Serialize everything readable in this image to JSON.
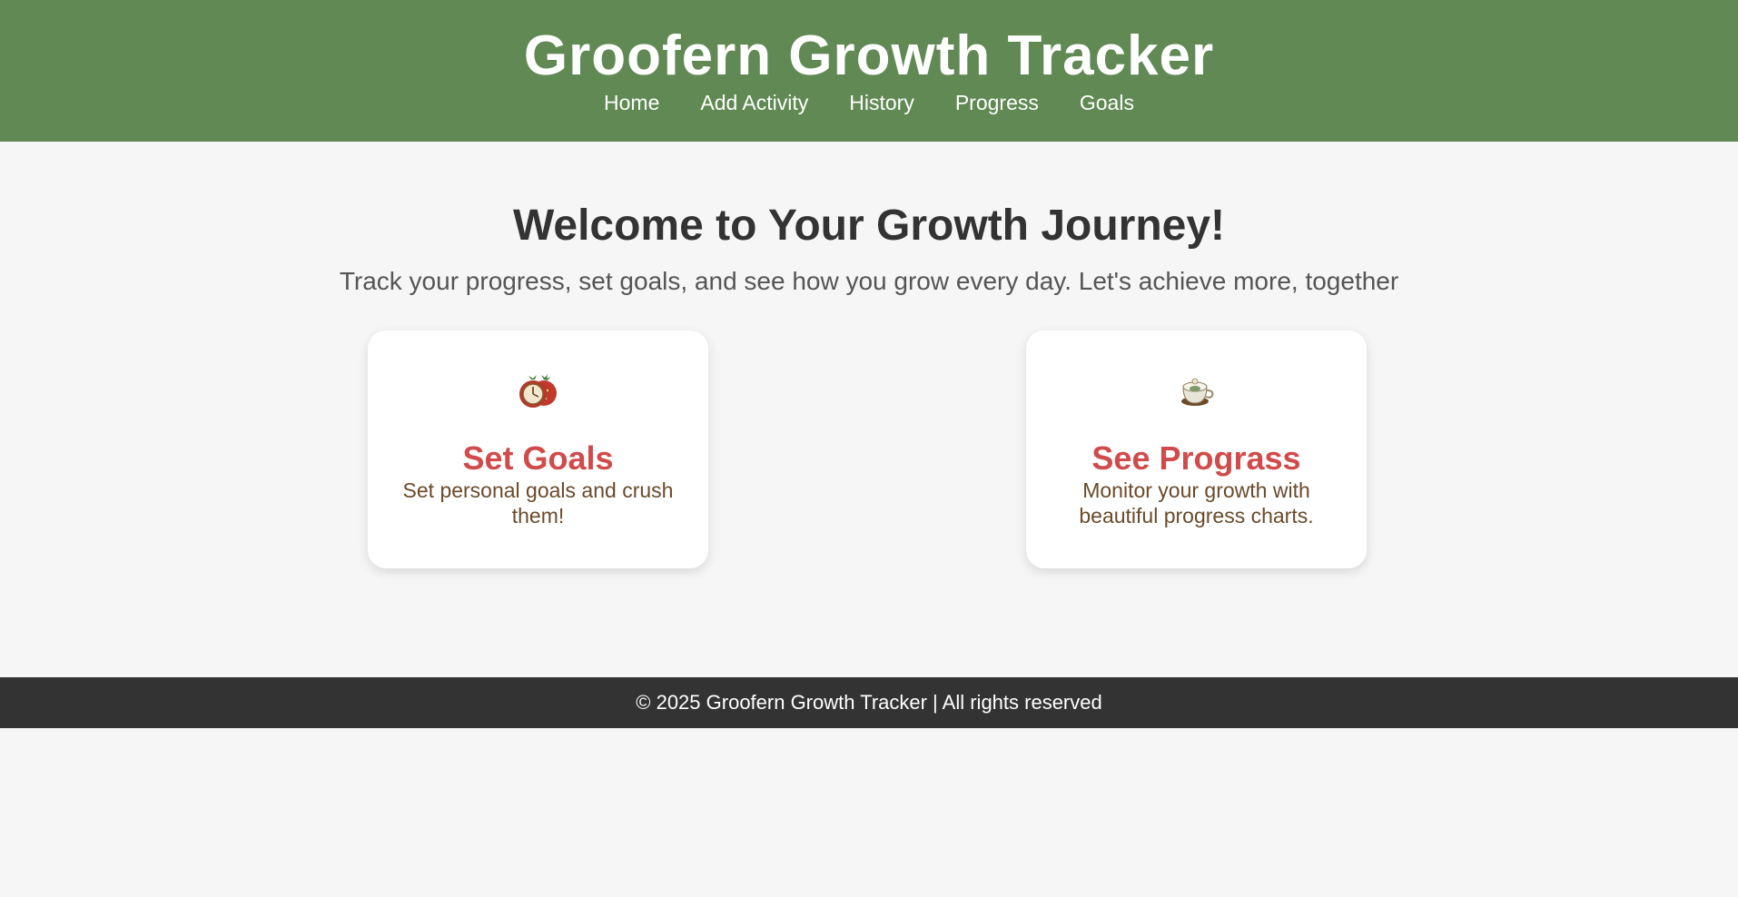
{
  "header": {
    "title": "Groofern Growth Tracker",
    "nav": [
      {
        "label": "Home"
      },
      {
        "label": "Add Activity"
      },
      {
        "label": "History"
      },
      {
        "label": "Progress"
      },
      {
        "label": "Goals"
      }
    ]
  },
  "main": {
    "title": "Welcome to Your Growth Journey!",
    "subtitle": "Track your progress, set goals, and see how you grow every day. Let's achieve more, together",
    "cards": [
      {
        "icon": "strawberry-clock-icon",
        "title": "Set Goals",
        "description": "Set personal goals and crush them!"
      },
      {
        "icon": "teacup-icon",
        "title": "See Prograss",
        "description": "Monitor your growth with beautiful progress charts."
      }
    ]
  },
  "footer": {
    "text": "© 2025 Groofern Growth Tracker | All rights reserved"
  },
  "colors": {
    "header_bg": "#618954",
    "page_bg": "#f6f6f6",
    "card_title": "#d14b4b",
    "card_text": "#6a4a2a",
    "footer_bg": "#333333"
  }
}
